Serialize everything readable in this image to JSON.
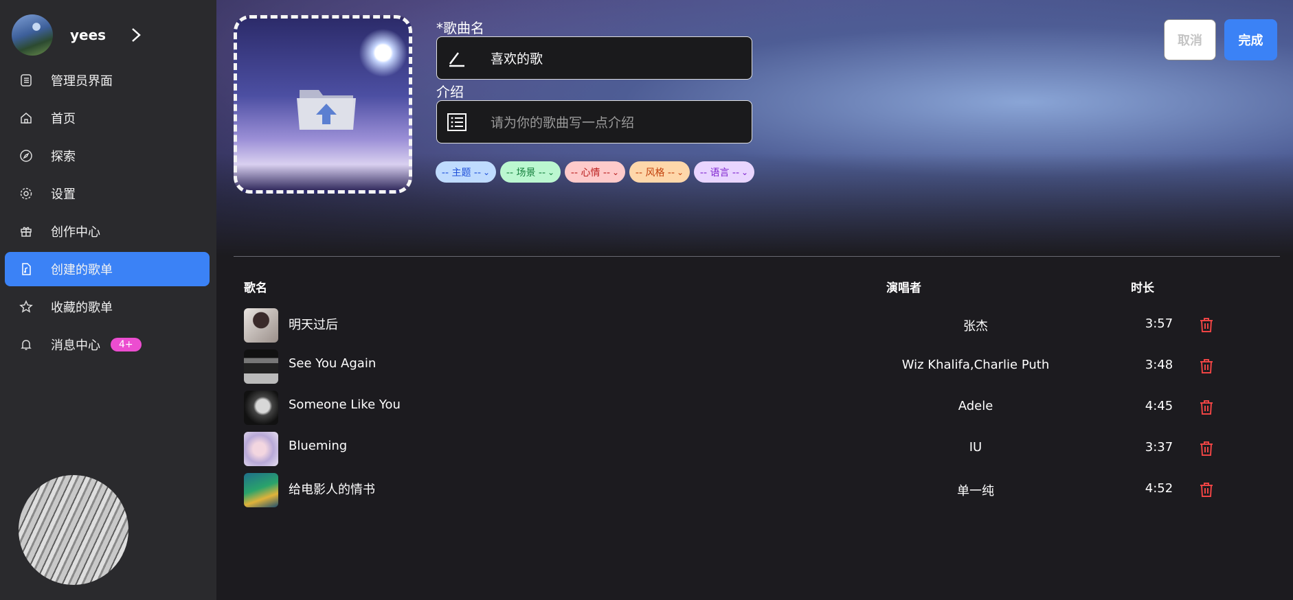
{
  "sidebar": {
    "username": "yees",
    "items": [
      {
        "label": "管理员界面",
        "icon": "admin-panel-icon"
      },
      {
        "label": "首页",
        "icon": "home-icon"
      },
      {
        "label": "探索",
        "icon": "compass-icon"
      },
      {
        "label": "设置",
        "icon": "gear-icon"
      },
      {
        "label": "创作中心",
        "icon": "gift-icon"
      },
      {
        "label": "创建的歌单",
        "icon": "music-file-icon",
        "active": true
      },
      {
        "label": "收藏的歌单",
        "icon": "star-icon"
      },
      {
        "label": "消息中心",
        "icon": "bell-icon",
        "badge": "4+"
      }
    ]
  },
  "editor": {
    "name_label": "*歌曲名",
    "name_value": "喜欢的歌",
    "intro_label": "介绍",
    "intro_placeholder": "请为你的歌曲写一点介绍",
    "tags": [
      {
        "label": "-- 主题 --",
        "bg": "#bfdbfe",
        "fg": "#1d4ed8"
      },
      {
        "label": "-- 场景 --",
        "bg": "#bbf7d0",
        "fg": "#15803d"
      },
      {
        "label": "-- 心情 --",
        "bg": "#fecaca",
        "fg": "#b91c1c"
      },
      {
        "label": "-- 风格 --",
        "bg": "#fed7aa",
        "fg": "#c2410c"
      },
      {
        "label": "-- 语言 --",
        "bg": "#e9d5ff",
        "fg": "#7e22ce"
      }
    ],
    "cancel_label": "取消",
    "done_label": "完成"
  },
  "table": {
    "headers": {
      "name": "歌名",
      "artist": "演唱者",
      "duration": "时长"
    },
    "rows": [
      {
        "name": "明天过后",
        "artist": "张杰",
        "duration": "3:57"
      },
      {
        "name": "See You Again",
        "artist": "Wiz Khalifa,Charlie Puth",
        "duration": "3:48"
      },
      {
        "name": "Someone Like You",
        "artist": "Adele",
        "duration": "4:45"
      },
      {
        "name": "Blueming",
        "artist": "IU",
        "duration": "3:37"
      },
      {
        "name": "给电影人的情书",
        "artist": "单一纯",
        "duration": "4:52"
      }
    ]
  },
  "colors": {
    "accent": "#3b82f6",
    "badge": "#ec4dd0",
    "delete": "#ef4444"
  }
}
